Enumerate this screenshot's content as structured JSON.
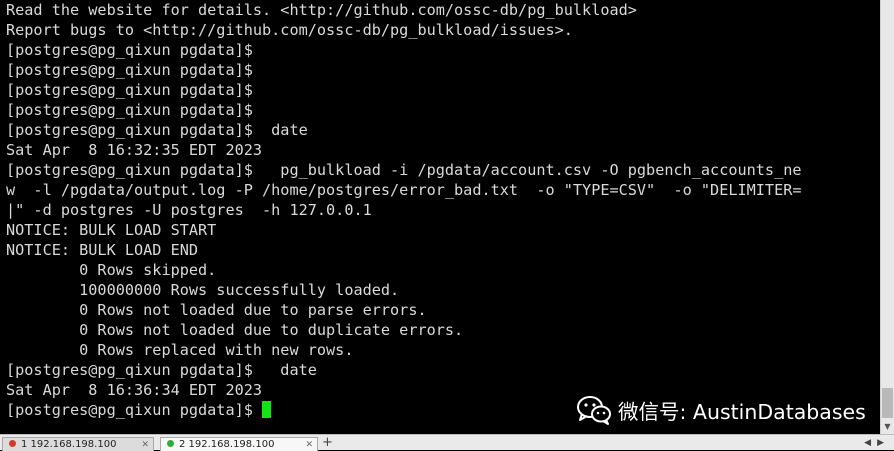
{
  "terminal": {
    "lines": [
      "Read the website for details. <http://github.com/ossc-db/pg_bulkload>",
      "Report bugs to <http://github.com/ossc-db/pg_bulkload/issues>.",
      "[postgres@pg_qixun pgdata]$",
      "[postgres@pg_qixun pgdata]$",
      "[postgres@pg_qixun pgdata]$",
      "[postgres@pg_qixun pgdata]$",
      "[postgres@pg_qixun pgdata]$  date",
      "Sat Apr  8 16:32:35 EDT 2023",
      "[postgres@pg_qixun pgdata]$   pg_bulkload -i /pgdata/account.csv -O pgbench_accounts_ne",
      "w  -l /pgdata/output.log -P /home/postgres/error_bad.txt  -o \"TYPE=CSV\"  -o \"DELIMITER=",
      "|\" -d postgres -U postgres  -h 127.0.0.1",
      "NOTICE: BULK LOAD START",
      "NOTICE: BULK LOAD END",
      "        0 Rows skipped.",
      "        100000000 Rows successfully loaded.",
      "        0 Rows not loaded due to parse errors.",
      "        0 Rows not loaded due to duplicate errors.",
      "        0 Rows replaced with new rows.",
      "[postgres@pg_qixun pgdata]$   date",
      "Sat Apr  8 16:36:34 EDT 2023",
      "[postgres@pg_qixun pgdata]$ "
    ],
    "text_color": "#d9d9d9",
    "background": "#000000",
    "cursor_color": "#13e513"
  },
  "tabs": [
    {
      "label": "1 192.168.198.100",
      "status_color": "#d23a2a"
    },
    {
      "label": "2 192.168.198.100",
      "status_color": "#2fae3a"
    }
  ],
  "icons": {
    "tab_close": "close-icon",
    "tab_new": "plus-icon",
    "scroll_down": "arrow-down-icon",
    "tab_prev": "chevron-left-icon",
    "tab_next": "chevron-right-icon",
    "watermark_logo": "wechat-icon"
  },
  "watermark": {
    "text": "微信号: AustinDatabases"
  }
}
